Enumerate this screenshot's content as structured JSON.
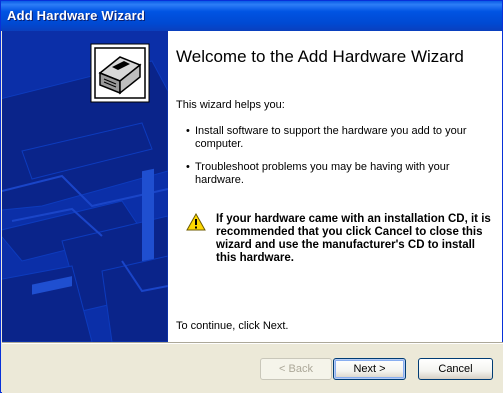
{
  "window": {
    "title": "Add Hardware Wizard"
  },
  "content": {
    "heading": "Welcome to the Add Hardware Wizard",
    "intro": "This wizard helps you:",
    "bullets": [
      "Install software to support the hardware you add to your computer.",
      "Troubleshoot problems you may be having with your hardware."
    ],
    "warning": "If your hardware came with an installation CD, it is recommended that you click Cancel to close this wizard and use the manufacturer's CD to install this hardware.",
    "continue_text": "To continue, click Next."
  },
  "footer": {
    "back_label": "< Back",
    "next_label": "Next >",
    "cancel_label": "Cancel"
  },
  "icons": {
    "wizard": "hardware-icon",
    "warning": "warning-icon"
  },
  "colors": {
    "titlebar": "#0054e3",
    "side_panel": "#0a2a9c",
    "dialog_face": "#ece9d8"
  }
}
